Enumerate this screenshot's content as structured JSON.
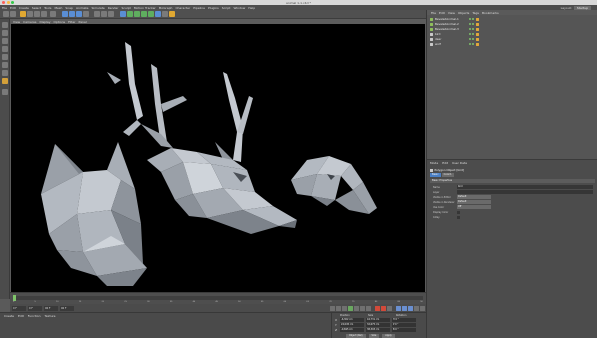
{
  "app": {
    "window_title": "animal 1-1.c4d *",
    "menus": [
      "File",
      "Edit",
      "Create",
      "Select",
      "Tools",
      "Mesh",
      "Snap",
      "Animate",
      "Simulate",
      "Render",
      "Sculpt",
      "Motion Tracker",
      "MoGraph",
      "Character",
      "Pipeline",
      "Plugins",
      "Script",
      "Window",
      "Help"
    ],
    "layout_label": "Layout:",
    "layout_value": "Startup"
  },
  "viewport": {
    "menus": [
      "View",
      "Cameras",
      "Display",
      "Options",
      "Filter",
      "Panel"
    ],
    "colors": {
      "background": "#000000",
      "mesh": "#a7adb5",
      "mesh_dark": "#6b7079"
    }
  },
  "timeline": {
    "ticks": [
      "0",
      "5",
      "10",
      "15",
      "20",
      "25",
      "30",
      "35",
      "40",
      "45",
      "50",
      "55",
      "60",
      "65",
      "70",
      "75",
      "80",
      "85",
      "90"
    ],
    "start_frame": "0 F",
    "current_frame": "0 F",
    "end_frame": "90 F",
    "end_frame_2": "90 F"
  },
  "materials": {
    "menus": [
      "Create",
      "Edit",
      "Function",
      "Texture"
    ]
  },
  "coordinates": {
    "headers": [
      "Position",
      "Size",
      "Rotation"
    ],
    "rows": [
      {
        "axis": "X",
        "pos": "-6,302 cm",
        "size": "44,731 cm",
        "rot": "H 0 °"
      },
      {
        "axis": "Y",
        "pos": "24,045 cm",
        "size": "32,675 cm",
        "rot": "P 0 °"
      },
      {
        "axis": "Z",
        "pos": "-0,695 cm",
        "size": "38,393 cm",
        "rot": "B 0 °"
      }
    ],
    "mode": "Object (Rel)",
    "size_mode": "Size",
    "apply": "Apply"
  },
  "object_manager": {
    "menus": [
      "File",
      "Edit",
      "View",
      "Objects",
      "Tags",
      "Bookmarks"
    ],
    "objects": [
      {
        "name": "BeveledAnimal-1",
        "type": "poly"
      },
      {
        "name": "BeveledAnimal-2",
        "type": "poly"
      },
      {
        "name": "BeveledAnimal-3",
        "type": "poly"
      },
      {
        "name": "bird",
        "type": "null"
      },
      {
        "name": "deer",
        "type": "null"
      },
      {
        "name": "wolf",
        "type": "null"
      }
    ]
  },
  "attributes": {
    "menus": [
      "Mode",
      "Edit",
      "User Data"
    ],
    "object_title": "Polygon Object [bird]",
    "tabs": [
      "Basic",
      "Coord."
    ],
    "section": "Basic Properties",
    "fields": [
      {
        "label": "Name",
        "value": "bird",
        "kind": "text"
      },
      {
        "label": "Layer",
        "value": "",
        "kind": "text"
      },
      {
        "label": "Visible in Editor",
        "value": "Default",
        "kind": "dropdown"
      },
      {
        "label": "Visible in Renderer",
        "value": "Default",
        "kind": "dropdown"
      },
      {
        "label": "Use Color",
        "value": "Off",
        "kind": "dropdown"
      },
      {
        "label": "Display Color",
        "value": "",
        "kind": "color"
      },
      {
        "label": "X-Ray",
        "value": "",
        "kind": "checkbox"
      }
    ]
  }
}
